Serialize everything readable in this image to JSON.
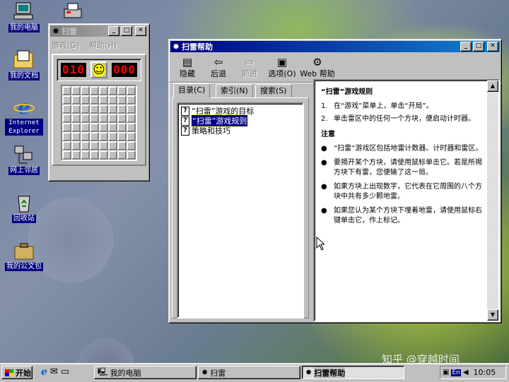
{
  "desktop": {
    "icons": [
      {
        "label": "我的电脑",
        "icon": "my-computer-icon"
      },
      {
        "label": "我的文档",
        "icon": "my-documents-icon"
      },
      {
        "label": "Internet Explorer",
        "icon": "internet-explorer-icon"
      },
      {
        "label": "网上邻居",
        "icon": "network-neighborhood-icon"
      },
      {
        "label": "回收站",
        "icon": "recycle-bin-icon"
      },
      {
        "label": "我的公文包",
        "icon": "briefcase-icon"
      }
    ],
    "watermark": "知乎 @穿越时间"
  },
  "minesweeper": {
    "title": "扫雷",
    "menu": [
      "游戏(G)",
      "帮助(H)"
    ],
    "mines_counter": "010",
    "timer": "000",
    "face": "☺",
    "rows": 8,
    "cols": 8
  },
  "help": {
    "title": "扫雷帮助",
    "toolbar": [
      {
        "label": "隐藏",
        "icon": "hide-icon",
        "enabled": true
      },
      {
        "label": "后退",
        "icon": "back-arrow-icon",
        "enabled": true
      },
      {
        "label": "前进",
        "icon": "forward-arrow-icon",
        "enabled": false
      },
      {
        "label": "选项(O)",
        "icon": "options-icon",
        "enabled": true
      },
      {
        "label": "Web 帮助",
        "icon": "web-help-icon",
        "enabled": true
      }
    ],
    "tabs": [
      "目录(C)",
      "索引(N)",
      "搜索(S)"
    ],
    "topics": [
      "“扫雷”游戏的目标",
      "“扫雷”游戏规则",
      "策略和技巧"
    ],
    "selected_topic": 1,
    "content": {
      "heading": "“扫雷”游戏规则",
      "steps": [
        "在“游戏”菜单上，单击“开局”。",
        "单击雷区中的任何一个方块，便启动计时器。"
      ],
      "notes_heading": "注意",
      "notes": [
        "“扫雷”游戏区包括地雷计数器、计时器和雷区。",
        "要揭开某个方块，请使用鼠标单击它。若是所揭方块下有雷，您便输了这一局。",
        "如果方块上出现数字，它代表在它周围的八个方块中共有多少颗地雷。",
        "如果您认为某个方块下埋着地雷，请使用鼠标右键单击它，作上标记。"
      ]
    }
  },
  "taskbar": {
    "start_label": "开始",
    "tasks": [
      "我的电脑",
      "扫雷",
      "扫雷帮助"
    ],
    "active_task": 2,
    "ime": "En",
    "clock": "10:05"
  }
}
